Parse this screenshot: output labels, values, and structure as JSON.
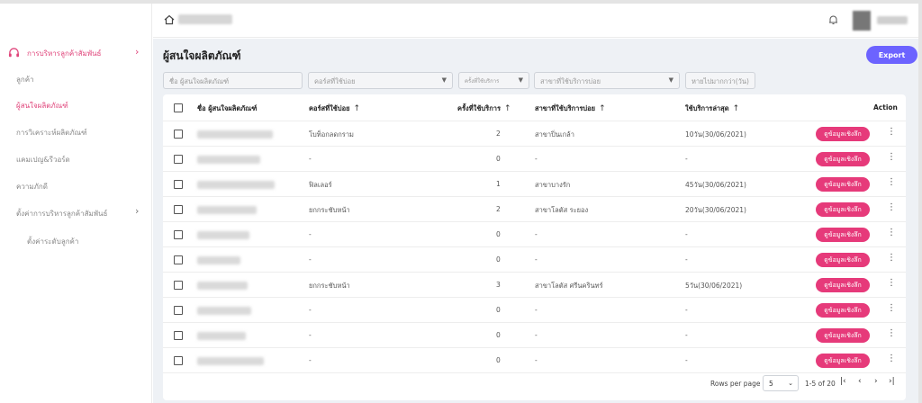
{
  "sidebar": {
    "group_label": "การบริหารลูกค้าสัมพันธ์",
    "items": [
      {
        "label": "ลูกค้า",
        "active": false
      },
      {
        "label": "ผู้สนใจผลิตภัณฑ์",
        "active": true
      },
      {
        "label": "การวิเคราะห์ผลิตภัณฑ์",
        "active": false
      },
      {
        "label": "แคมเปญ&รีวอร์ด",
        "active": false
      },
      {
        "label": "ความภักดี",
        "active": false
      },
      {
        "label": "ตั้งค่าการบริหารลูกค้าสัมพันธ์",
        "active": false,
        "has_submenu": true
      },
      {
        "label": "ตั้งค่าระดับลูกค้า",
        "active": false
      }
    ]
  },
  "header": {
    "breadcrumb": "",
    "user_name": ""
  },
  "page": {
    "title": "ผู้สนใจผลิตภัณฑ์",
    "export_label": "Export"
  },
  "filters": {
    "name_placeholder": "ชื่อ ผู้สนใจผลิตภัณฑ์",
    "course_placeholder": "คอร์สที่ใช้บ่อย",
    "count_placeholder": "ครั้งที่ใช้บริการ",
    "branch_placeholder": "สาขาที่ใช้บริการบ่อย",
    "days_placeholder": "หายไปมากกว่า(วัน)"
  },
  "table": {
    "columns": {
      "name": "ชื่อ ผู้สนใจผลิตภัณฑ์",
      "course": "คอร์สที่ใช้บ่อย",
      "count": "ครั้งที่ใช้บริการ",
      "branch": "สาขาที่ใช้บริการบ่อย",
      "last": "ใช้บริการล่าสุด",
      "action": "Action"
    },
    "detail_label": "ดูข้อมูลเชิงลึก",
    "rows": [
      {
        "name": "",
        "course": "โบท็อกลดกราม",
        "count": "2",
        "branch": "สาขาปิ่นเกล้า",
        "last": "10วัน(30/06/2021)"
      },
      {
        "name": "",
        "course": "-",
        "count": "0",
        "branch": "-",
        "last": "-"
      },
      {
        "name": "",
        "course": "ฟิลเลอร์",
        "count": "1",
        "branch": "สาขาบางรัก",
        "last": "45วัน(30/06/2021)"
      },
      {
        "name": "",
        "course": "ยกกระชับหน้า",
        "count": "2",
        "branch": "สาขาโลตัส ระยอง",
        "last": "20วัน(30/06/2021)"
      },
      {
        "name": "",
        "course": "-",
        "count": "0",
        "branch": "-",
        "last": "-"
      },
      {
        "name": "",
        "course": "-",
        "count": "0",
        "branch": "-",
        "last": "-"
      },
      {
        "name": "",
        "course": "ยกกระชับหน้า",
        "count": "3",
        "branch": "สาขาโลตัส ศรีนครินทร์",
        "last": "5วัน(30/06/2021)"
      },
      {
        "name": "",
        "course": "-",
        "count": "0",
        "branch": "-",
        "last": "-"
      },
      {
        "name": "",
        "course": "-",
        "count": "0",
        "branch": "-",
        "last": "-"
      },
      {
        "name": "",
        "course": "-",
        "count": "0",
        "branch": "-",
        "last": "-"
      }
    ]
  },
  "pagination": {
    "rows_per_page_label": "Rows per page",
    "rows_per_page": "5",
    "range": "1-5 of 20"
  },
  "colors": {
    "accent_pink": "#e63a7a",
    "export_purple": "#6c63ff",
    "background": "#eef1f5"
  },
  "icons": [
    "home-icon",
    "bell-icon",
    "chevron-right-icon",
    "arrow-up-icon",
    "kebab-icon",
    "first-page-icon",
    "prev-page-icon",
    "next-page-icon",
    "last-page-icon"
  ]
}
